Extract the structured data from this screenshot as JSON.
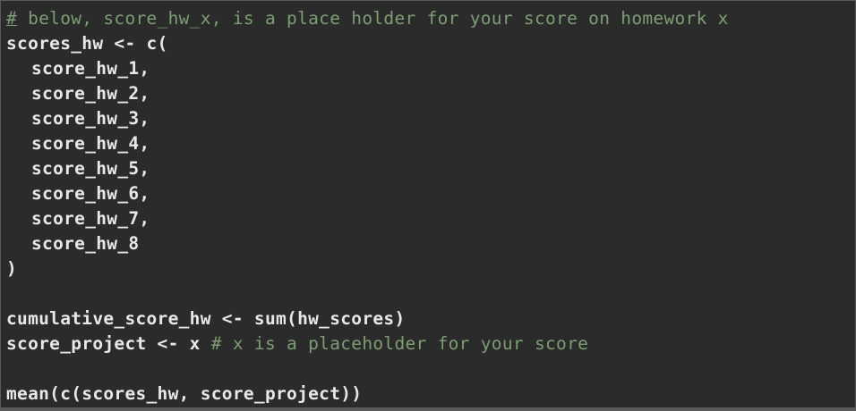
{
  "colors": {
    "background": "#2b2b2b",
    "code_text": "#e8e8e8",
    "comment_text": "#7d9d74"
  },
  "code": {
    "line1_hash": "#",
    "line1_comment": " below, score_hw_x, is a place holder for your score on homework x",
    "line2": "scores_hw <- c(",
    "hw_items": [
      "score_hw_1,",
      "score_hw_2,",
      "score_hw_3,",
      "score_hw_4,",
      "score_hw_5,",
      "score_hw_6,",
      "score_hw_7,",
      "score_hw_8"
    ],
    "close_paren": ")",
    "cumulative_line": "cumulative_score_hw <- sum(hw_scores)",
    "project_code": "score_project <- x ",
    "project_comment": "# x is a placeholder for your score",
    "mean_line": "mean(c(scores_hw, score_project))"
  }
}
